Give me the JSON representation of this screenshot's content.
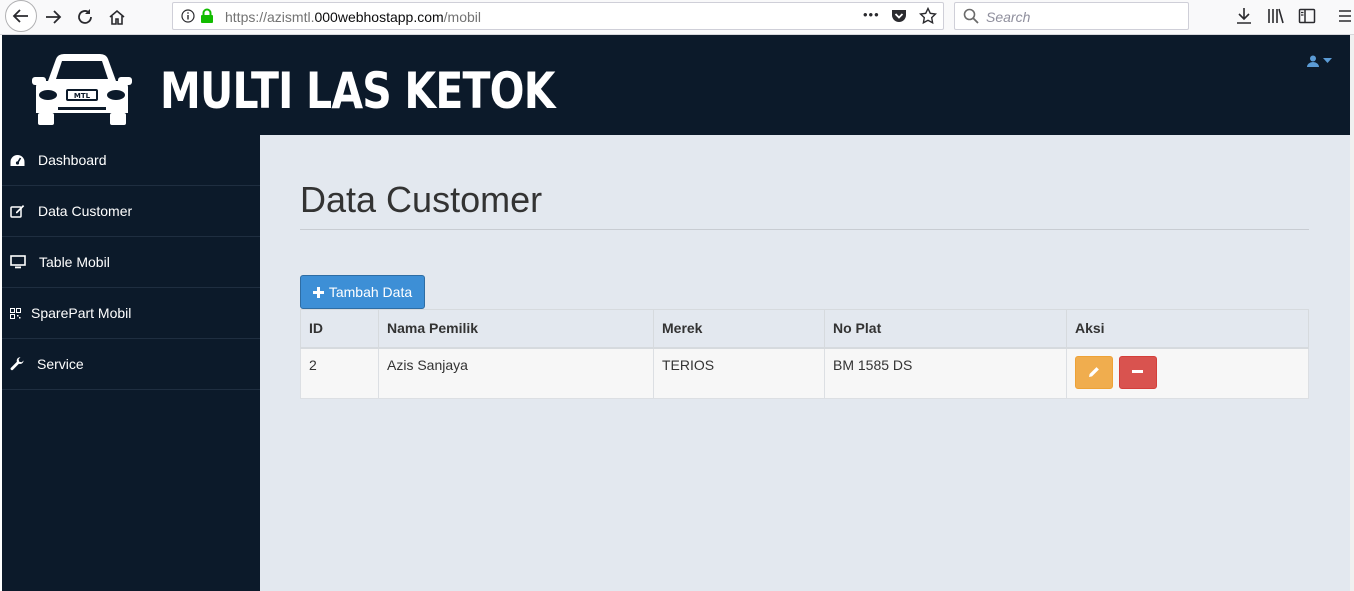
{
  "browser": {
    "url_prefix": "https://azismtl.",
    "url_host": "000webhostapp.com",
    "url_path": "/mobil",
    "search_placeholder": "Search",
    "menu_dots": "•••"
  },
  "header": {
    "brand": "MULTI LAS KETOK",
    "plate_text": "MTL"
  },
  "sidebar": {
    "items": [
      {
        "label": "Dashboard",
        "icon": "dashboard-icon"
      },
      {
        "label": "Data Customer",
        "icon": "edit-icon"
      },
      {
        "label": "Table Mobil",
        "icon": "monitor-icon"
      },
      {
        "label": "SparePart Mobil",
        "icon": "qrcode-icon"
      },
      {
        "label": "Service",
        "icon": "wrench-icon"
      }
    ]
  },
  "main": {
    "title": "Data Customer",
    "add_button": "Tambah Data",
    "table": {
      "columns": [
        "ID",
        "Nama Pemilik",
        "Merek",
        "No Plat",
        "Aksi"
      ],
      "rows": [
        [
          "2",
          "Azis Sanjaya",
          "TERIOS",
          "BM 1585 DS"
        ]
      ]
    }
  },
  "colors": {
    "header_bg": "#0c1a2a",
    "main_bg": "#e3e8ef",
    "primary": "#3d8fd6",
    "warning": "#f0ad4e",
    "danger": "#d9534f"
  }
}
